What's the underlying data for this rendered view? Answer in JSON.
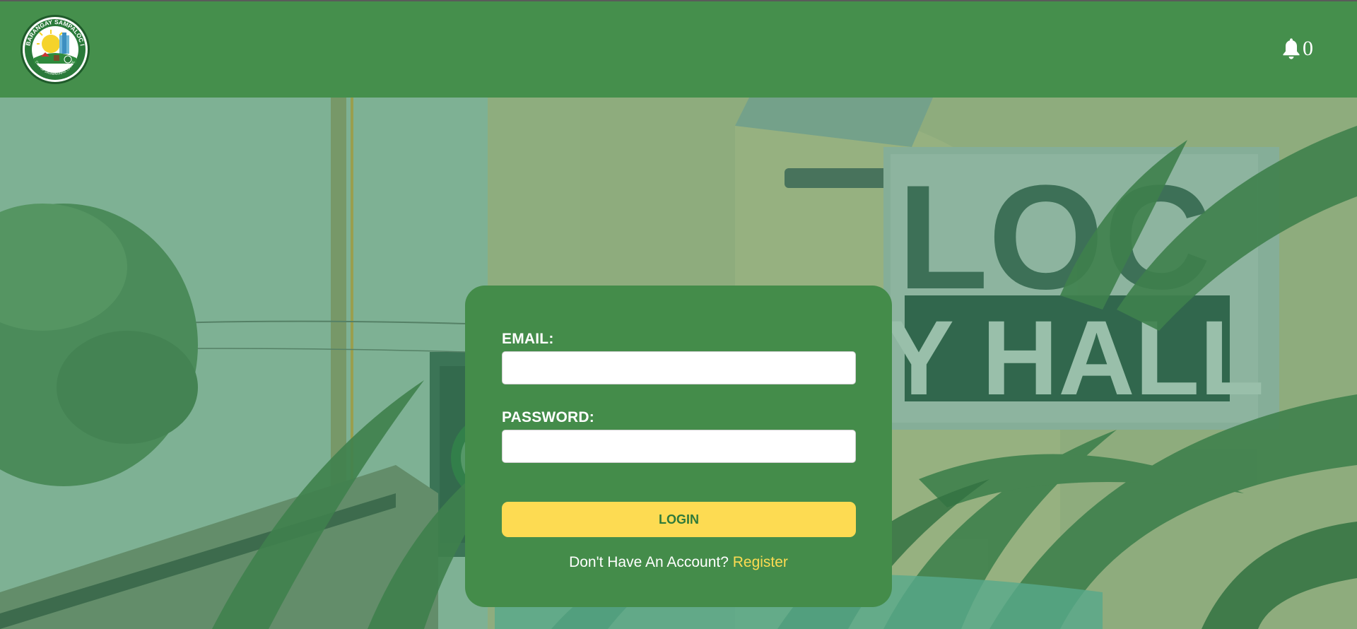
{
  "header": {
    "logo_alt": "Barangay Sampaloc I logo",
    "logo_text": "BARANGAY SAMPALOC I",
    "logo_subtext": "CITY OF DASMARIÑAS, CAVITE",
    "notification_icon": "bell-icon",
    "notification_count": "0"
  },
  "login": {
    "email_label": "EMAIL:",
    "email_value": "",
    "password_label": "PASSWORD:",
    "password_value": "",
    "login_label": "LOGIN",
    "register_prompt": "Don't Have An Account?",
    "register_link": "Register"
  },
  "background": {
    "sign_text_top": "LOC",
    "sign_text_bottom": "Y HALL"
  },
  "colors": {
    "header_bg": "#458f4c",
    "card_bg": "#448c4a",
    "button_bg": "#fddb52",
    "button_text": "#2f7a3a",
    "link": "#fddb52"
  }
}
